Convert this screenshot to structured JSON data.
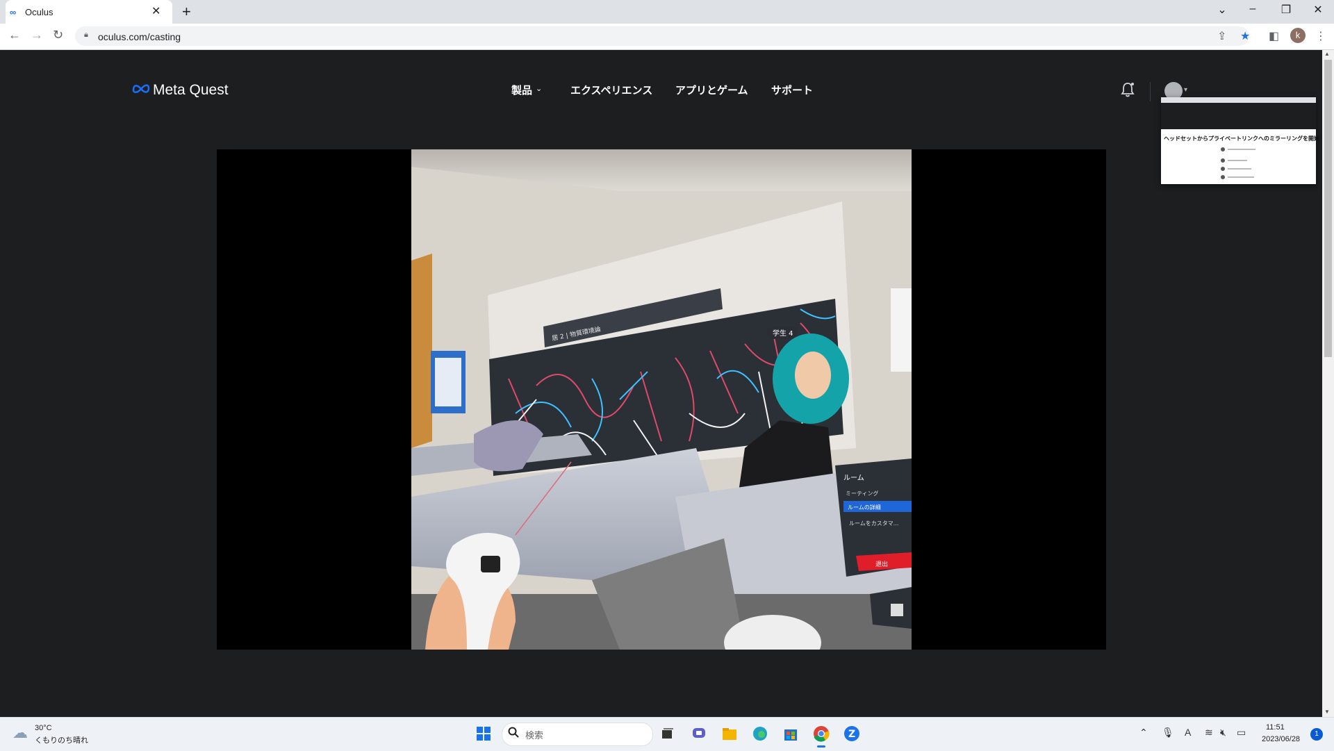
{
  "browser": {
    "tab_title": "Oculus",
    "url": "oculus.com/casting",
    "profile_initial": "k"
  },
  "site": {
    "logo_text": "Meta Quest",
    "nav": [
      {
        "label": "製品"
      },
      {
        "label": "エクスペリエンス"
      },
      {
        "label": "アプリとゲーム"
      },
      {
        "label": "サポート"
      }
    ]
  },
  "thumbnail": {
    "title": "ヘッドセットからプライベートリンクへのミラーリングを開始"
  },
  "vr_scene": {
    "board_title": "居 2 | 物質環境論",
    "name_tag": "学生 4",
    "menu": {
      "header": "ルーム",
      "items": [
        "ミーティング",
        "ルームの詳細",
        "ルームをカスタマ..."
      ],
      "leave": "退出"
    }
  },
  "taskbar": {
    "weather_temp": "30°C",
    "weather_desc": "くもりのち晴れ",
    "search_placeholder": "検索",
    "time": "11:51",
    "date": "2023/06/28",
    "notifications": "1"
  },
  "colors": {
    "page_bg": "#1c1e20",
    "accent_blue": "#1a6ef5",
    "leave_red": "#e01e2a"
  }
}
